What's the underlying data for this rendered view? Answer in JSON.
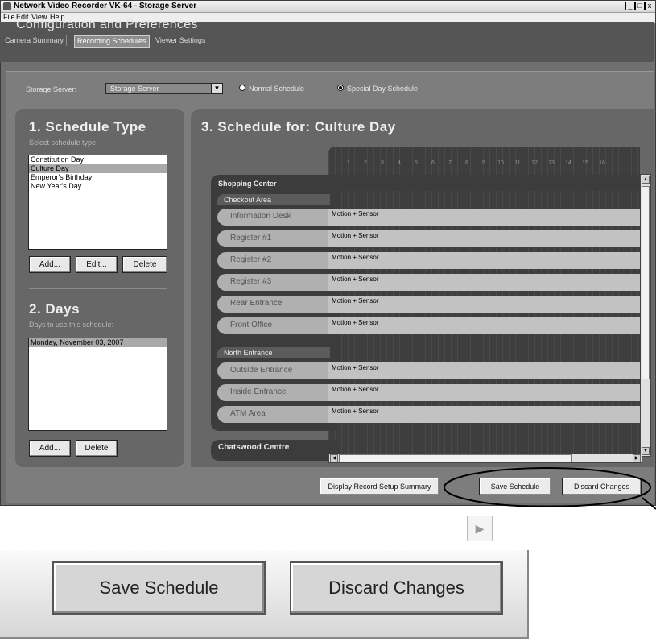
{
  "window": {
    "title": "Network Video Recorder VK-64 - Storage Server",
    "minimize": "_",
    "maximize": "□",
    "close": "x"
  },
  "menu": [
    "File",
    "Edit",
    "View",
    "Help"
  ],
  "header": {
    "title": "Configuration and Preferences",
    "tabs": [
      "Camera Summary",
      "Recording Schedules",
      "Viewer Settings"
    ],
    "active_tab": "Recording Schedules"
  },
  "storage": {
    "label": "Storage Server:",
    "selected": "Storage Server",
    "radio_normal": "Normal Schedule",
    "radio_special": "Special Day Schedule",
    "selected_radio": "Special Day Schedule"
  },
  "schedule_type": {
    "title": "1. Schedule Type",
    "subtitle": "Select schedule type:",
    "items": [
      "Constitution Day",
      "Culture Day",
      "Emperor's Birthday",
      "New Year's Day"
    ],
    "selected": "Culture Day",
    "add": "Add...",
    "edit": "Edit...",
    "delete": "Delete"
  },
  "days": {
    "title": "2. Days",
    "subtitle": "Days to use this schedule:",
    "items": [
      "Monday, November 03, 2007"
    ],
    "add": "Add...",
    "delete": "Delete"
  },
  "schedule": {
    "title": "3. Schedule for: Culture Day",
    "hours": [
      "1",
      "2",
      "3",
      "4",
      "5",
      "6",
      "7",
      "8",
      "9",
      "10",
      "11",
      "12",
      "13",
      "14",
      "15",
      "16"
    ],
    "groups": [
      {
        "name": "Shopping Center",
        "areas": [
          {
            "name": "Checkout Area",
            "cameras": [
              {
                "name": "Information Desk",
                "mode": "Motion + Sensor"
              },
              {
                "name": "Register #1",
                "mode": "Motion + Sensor"
              },
              {
                "name": "Register #2",
                "mode": "Motion + Sensor"
              },
              {
                "name": "Register #3",
                "mode": "Motion + Sensor"
              },
              {
                "name": "Rear Entrance",
                "mode": "Motion + Sensor"
              },
              {
                "name": "Front Office",
                "mode": "Motion + Sensor"
              }
            ]
          },
          {
            "name": "North Entrance",
            "cameras": [
              {
                "name": "Outside Entrance",
                "mode": "Motion + Sensor"
              },
              {
                "name": "Inside Entrance",
                "mode": "Motion + Sensor"
              },
              {
                "name": "ATM Area",
                "mode": "Motion + Sensor"
              }
            ]
          }
        ]
      },
      {
        "name": "Chatswood Centre",
        "areas": []
      }
    ]
  },
  "actions": {
    "summary": "Display Record Setup Summary",
    "save": "Save Schedule",
    "discard": "Discard Changes"
  },
  "icons": {
    "app": "video-recorder-icon",
    "dropdown": "chevron-down-icon",
    "scroll_up": "arrow-up-icon",
    "scroll_down": "arrow-down-icon",
    "scroll_left": "arrow-left-icon",
    "scroll_right": "arrow-right-icon"
  },
  "colors": {
    "window_bg": "#6f6f6f",
    "panel_bg": "#676767",
    "row_bg": "#b0b0b0",
    "highlight_ellipse": "#000000"
  }
}
